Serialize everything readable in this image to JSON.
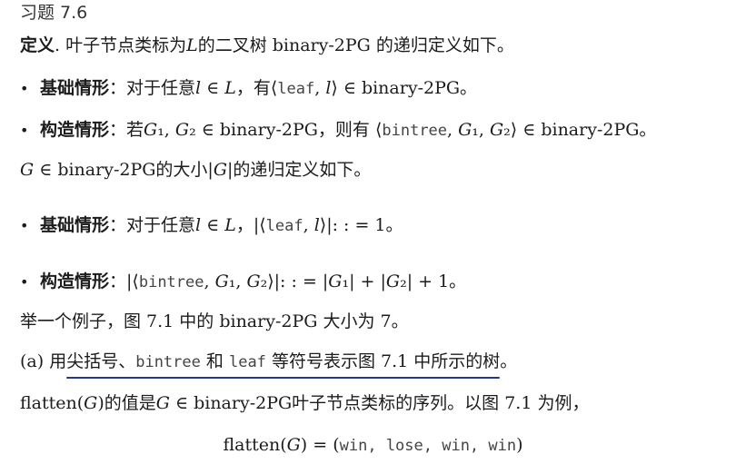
{
  "heading": {
    "title": "习题 7.6"
  },
  "definition": {
    "label": "定义",
    "text": ". 叶子节点类标为𝐿的二叉树 binary-2PG 的递归定义如下。"
  },
  "base_case_1": {
    "label": "基础情形",
    "text_before": "：对于任意𝑙 ∈ 𝐿，有⟨",
    "code": "leaf",
    "text_after": ", 𝑙⟩ ∈ binary-2PG。"
  },
  "construct_case_1": {
    "label": "构造情形",
    "text_before": "：若𝐺₁, 𝐺₂ ∈ binary-2PG，则有 ⟨",
    "code": "bintree",
    "text_after": ", 𝐺₁, 𝐺₂⟩ ∈ binary-2PG。"
  },
  "size_intro": {
    "text": "𝐺 ∈ binary-2PG的大小|𝐺|的递归定义如下。"
  },
  "base_case_2": {
    "label": "基础情形",
    "text_before": "：对于任意𝑙 ∈ 𝐿，|⟨",
    "code": "leaf",
    "text_after": ", 𝑙⟩|: : = 1。"
  },
  "construct_case_2": {
    "label": "构造情形",
    "text_before": "：|⟨",
    "code": "bintree",
    "text_after": ", 𝐺₁, 𝐺₂⟩|: : = |𝐺₁| + |𝐺₂| + 1。"
  },
  "example": {
    "text": "举一个例子，图 7.1 中的 binary-2PG 大小为 7。"
  },
  "question_a": {
    "prefix": "(a) 用",
    "underlined_1": "尖括号、",
    "code_1": "bintree",
    "underlined_2": " 和 ",
    "code_2": "leaf",
    "underlined_3": " 等符号表示图 7.1 中所示的树",
    "suffix": "。"
  },
  "flatten_intro": {
    "text": "flatten(𝐺)的值是𝐺 ∈ binary-2PG叶子节点类标的序列。以图 7.1 为例，"
  },
  "flatten_example": {
    "lhs": "flatten(𝐺) = (",
    "values": "win, lose, win, win",
    "rhs": ")"
  },
  "colors": {
    "text": "#1c1c1c",
    "underline": "#1f3a8a"
  }
}
